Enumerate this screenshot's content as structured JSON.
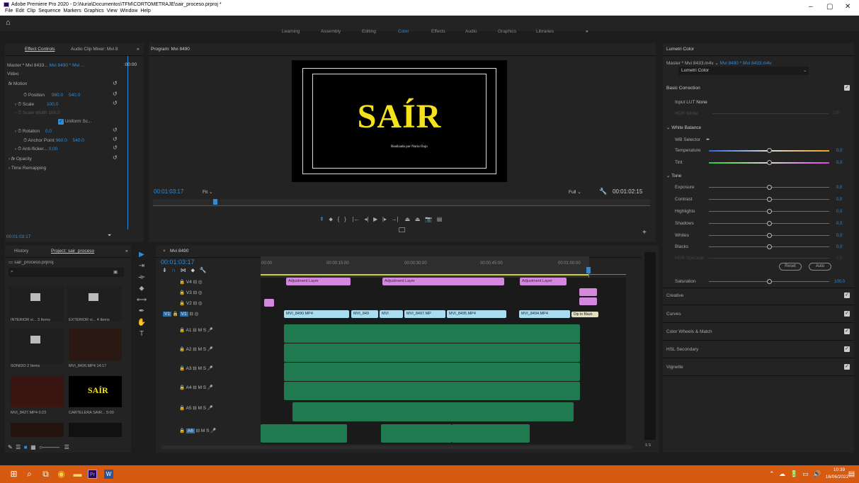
{
  "titlebar": {
    "title": "Adobe Premiere Pro 2020 - D:\\Nuria\\Documentos\\TFM\\CORTOMETRAJE\\sair_proceso.prproj *",
    "menu": [
      "File",
      "Edit",
      "Clip",
      "Sequence",
      "Markers",
      "Graphics",
      "View",
      "Window",
      "Help"
    ],
    "min": "–",
    "max": "▢",
    "close": "✕"
  },
  "workspaces": [
    "Learning",
    "Assembly",
    "Editing",
    "Color",
    "Effects",
    "Audio",
    "Graphics",
    "Libraries"
  ],
  "workspace_active": "Color",
  "effect_controls": {
    "tab": "Effect Controls",
    "tab2": "Audio Clip Mixer: Mvi 8",
    "source": "Master * Mvi 8433...",
    "seq": "Mvi 8490 * Mvi ...",
    "video": "Video",
    "motion": "Motion",
    "position_label": "Position",
    "position_x": "960,0",
    "position_y": "540,0",
    "scale_label": "Scale",
    "scale_val": "100,0",
    "scale_width_label": "Scale Width",
    "scale_width_val": "100,0",
    "uniform": "Uniform Sc...",
    "rotation_label": "Rotation",
    "rotation_val": "0,0",
    "anchor_label": "Anchor Point",
    "anchor_x": "960,0",
    "anchor_y": "540,0",
    "antiflicker_label": "Anti-flicker...",
    "antiflicker_val": "0,00",
    "opacity": "Opacity",
    "time_remap": "Time Remapping",
    "timecode": "00:01:03:17",
    "ruler": ":00:00"
  },
  "program": {
    "tab": "Program: Mvi 8490",
    "title_text": "SAÍR",
    "credit": "Realizado por Nuria Oujo",
    "timecode": "00:01:03:17",
    "fit": "Fit",
    "quality": "Full",
    "duration": "00:01:02:15"
  },
  "project": {
    "tab_history": "History",
    "tab_project": "Project: sair_proceso",
    "file": "sair_proceso.prproj",
    "items": [
      {
        "name": "INTERIOR vi...",
        "meta": "3 Items"
      },
      {
        "name": "EXTERIOR vi...",
        "meta": "4 Items"
      },
      {
        "name": "SONIDO",
        "meta": "2 Items"
      },
      {
        "name": "MVI_8426.MP4",
        "meta": "14:17"
      },
      {
        "name": "MVI_8427.MP4",
        "meta": "0:23"
      },
      {
        "name": "CARTELERA SAIR...",
        "meta": "5:00"
      }
    ]
  },
  "timeline": {
    "tab": "Mvi 8490",
    "timecode": "00:01:03:17",
    "ruler": [
      "00:00",
      "00:00:15:00",
      "00:00:30:00",
      "00:00:45:00",
      "00:01:00:00"
    ],
    "video_tracks": [
      "V4",
      "V3",
      "V2",
      "V1"
    ],
    "audio_tracks": [
      "A1",
      "A2",
      "A3",
      "A4",
      "A5",
      "A6"
    ],
    "adj_label": "Adjustment Layer",
    "v1_clips": [
      "MVI_8490.MP4",
      "MVI_849",
      "MVI",
      "MVI_8497.MP",
      "MVI_8495.MP4",
      "MVI_8494.MP4",
      "Dip to Black"
    ],
    "ms": "M   S",
    "meter_label": "S S"
  },
  "lumetri": {
    "tab": "Lumetri Color",
    "source": "Master * Mvi 8433.m4v",
    "seq": "Mvi 8490 * Mvi 8433.m4v",
    "fx": "Lumetri Color",
    "basic": "Basic Correction",
    "lut_label": "Input LUT",
    "lut_val": "None",
    "hdr_white": "HDR White",
    "wb": "White Balance",
    "wb_sel": "WB Selector",
    "temperature": "Temperature",
    "temperature_val": "0,0",
    "tint": "Tint",
    "tint_val": "0,0",
    "tone": "Tone",
    "exposure": "Exposure",
    "contrast": "Contrast",
    "highlights": "Highlights",
    "shadows": "Shadows",
    "whites": "Whites",
    "blacks": "Blacks",
    "hdr_spec": "HDR Specular",
    "zero": "0,0",
    "hdr_white_val": "100",
    "reset": "Reset",
    "auto": "Auto",
    "saturation": "Saturation",
    "saturation_val": "100,0",
    "sections": [
      "Creative",
      "Curves",
      "Color Wheels & Match",
      "HSL Secondary",
      "Vignette"
    ]
  },
  "taskbar": {
    "time": "10:39",
    "date": "16/06/2022"
  },
  "colors": {
    "accent": "#2e8ddb",
    "adjustment": "#d388dd",
    "video_clip": "#a8dcf0",
    "audio_clip": "#1f7a4f",
    "taskbar": "#d65a0f"
  }
}
